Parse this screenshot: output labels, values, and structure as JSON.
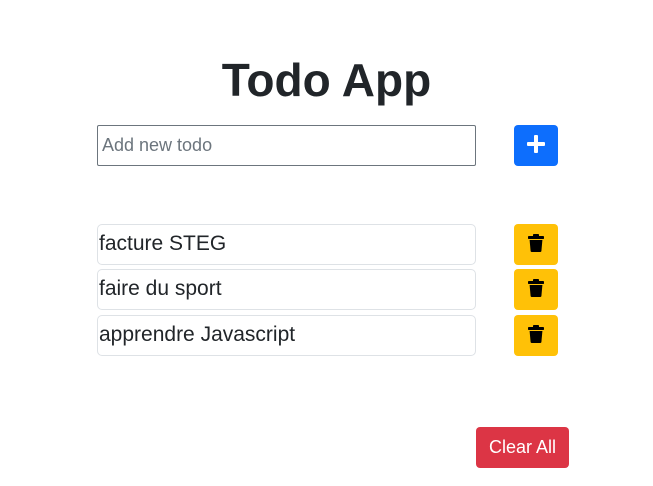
{
  "header": {
    "title": "Todo App"
  },
  "new_todo": {
    "placeholder": "Add new todo",
    "value": ""
  },
  "add_button": {
    "icon": "plus-icon",
    "color": "#0d6efd"
  },
  "todos": [
    {
      "text": "facture STEG",
      "delete_icon": "trash-icon"
    },
    {
      "text": "faire du sport",
      "delete_icon": "trash-icon"
    },
    {
      "text": "apprendre Javascript",
      "delete_icon": "trash-icon"
    }
  ],
  "delete_button_color": "#ffc107",
  "clear_button": {
    "label": "Clear All",
    "color": "#dc3545"
  }
}
